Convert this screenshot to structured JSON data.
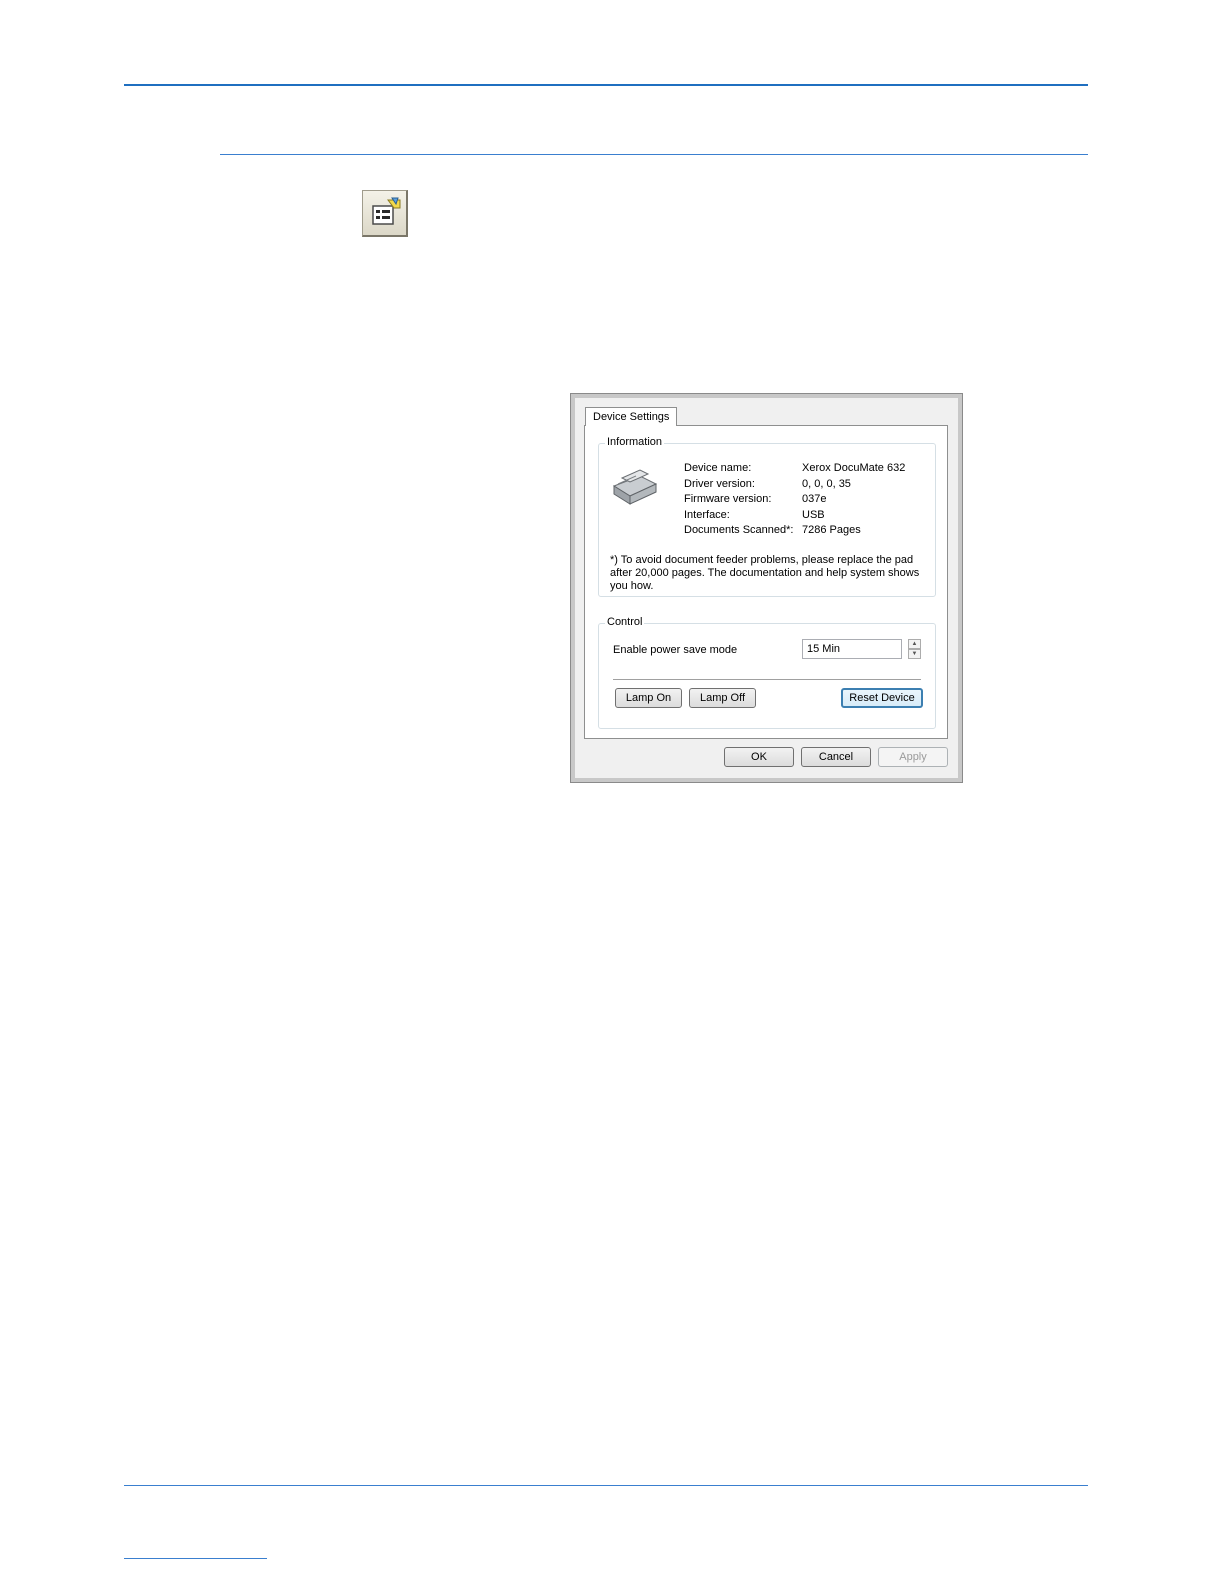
{
  "dialog": {
    "tab_label": "Device Settings",
    "information": {
      "title": "Information",
      "rows": [
        {
          "label": "Device name:",
          "value": "Xerox DocuMate 632"
        },
        {
          "label": "Driver version:",
          "value": "0, 0, 0, 35"
        },
        {
          "label": "Firmware version:",
          "value": "037e"
        },
        {
          "label": "Interface:",
          "value": "USB"
        },
        {
          "label": "Documents Scanned*:",
          "value": "7286 Pages"
        }
      ],
      "note": "*) To avoid document feeder problems, please replace the pad after 20,000 pages. The documentation and help system shows you how."
    },
    "control": {
      "title": "Control",
      "power_save_label": "Enable power save mode",
      "power_save_value": "15 Min",
      "lamp_on_label": "Lamp On",
      "lamp_off_label": "Lamp Off",
      "reset_label": "Reset Device"
    },
    "buttons": {
      "ok": "OK",
      "cancel": "Cancel",
      "apply": "Apply"
    }
  },
  "colors": {
    "rule": "#1f6fc0",
    "focus_border": "#3c7fb1"
  },
  "icons": {
    "toolbar_icon": "device-settings-icon",
    "scanner_icon": "scanner-icon"
  }
}
